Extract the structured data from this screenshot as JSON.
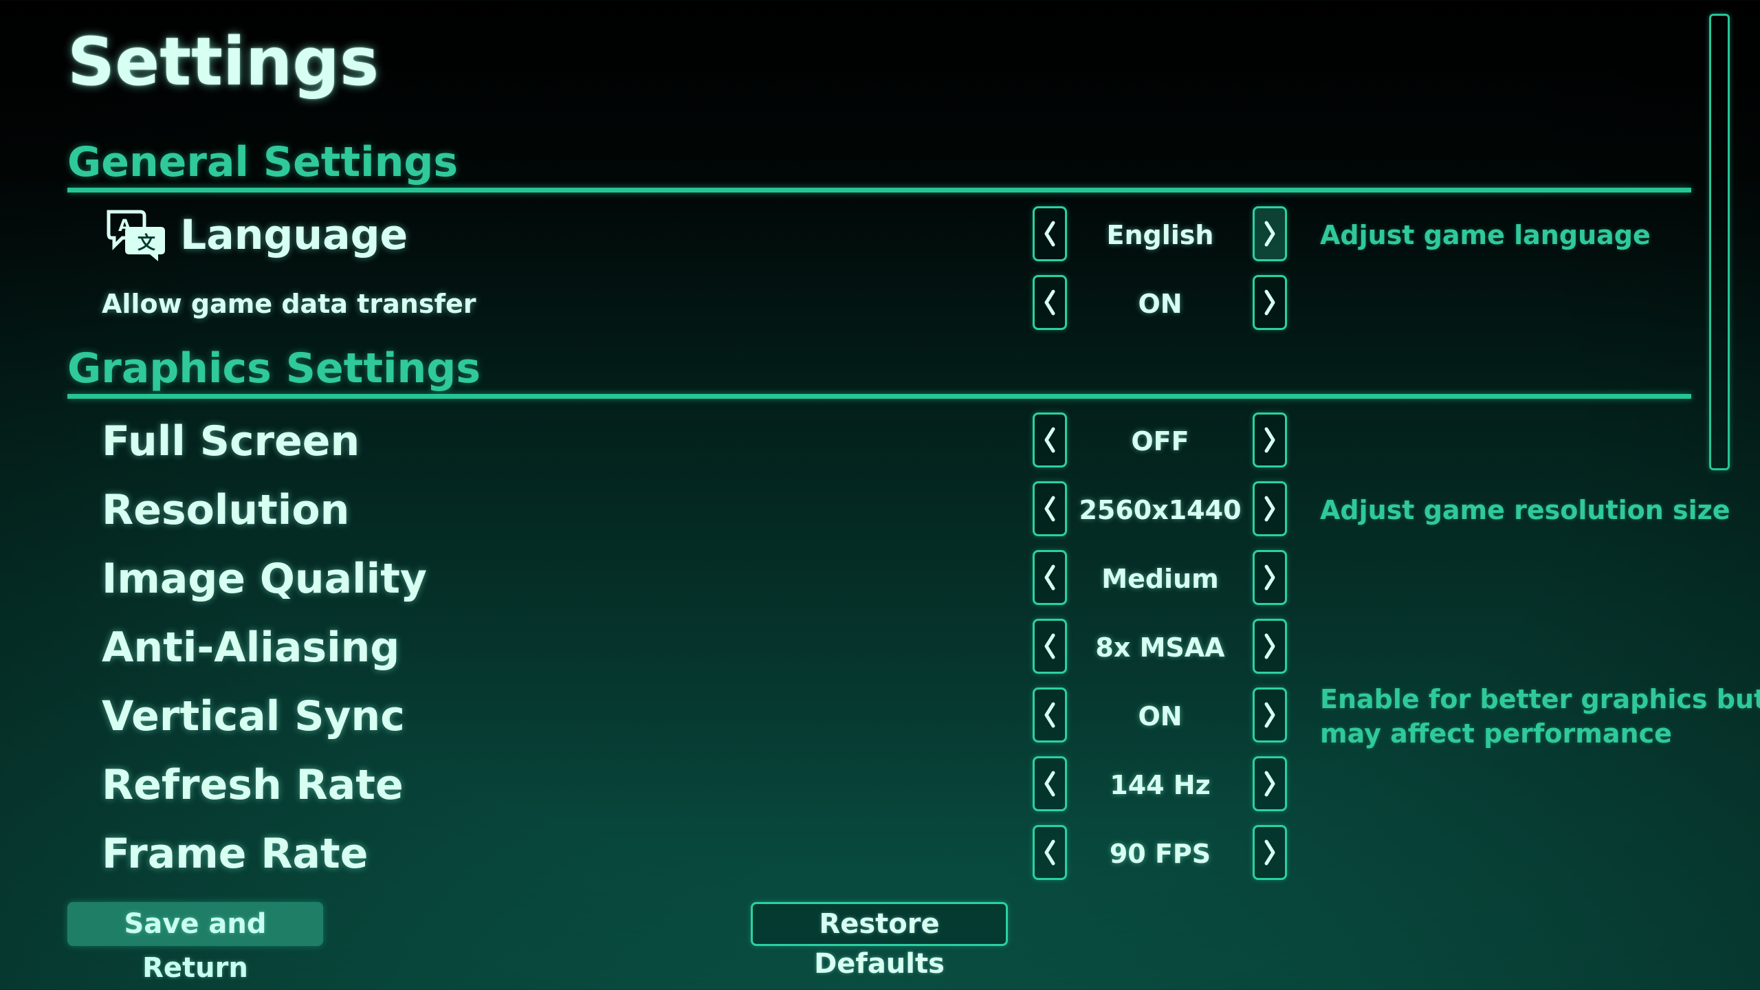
{
  "page_title": "Settings",
  "colors": {
    "accent": "#2fc99a",
    "text": "#d7fff2",
    "background_top": "#000000",
    "background_bottom": "#0a5648"
  },
  "general": {
    "title": "General Settings",
    "language": {
      "icon": "language-translate-icon",
      "label": "Language",
      "value": "English",
      "hint": "Adjust game language",
      "prev_icon": "chevron-left-icon",
      "next_icon": "chevron-right-icon"
    },
    "data_transfer": {
      "label": "Allow game data transfer",
      "value": "ON"
    }
  },
  "graphics": {
    "title": "Graphics Settings",
    "full_screen": {
      "label": "Full Screen",
      "value": "OFF"
    },
    "resolution": {
      "label": "Resolution",
      "value": "2560x1440",
      "hint": "Adjust game resolution size"
    },
    "image_quality": {
      "label": "Image Quality",
      "value": "Medium"
    },
    "anti_aliasing": {
      "label": "Anti-Aliasing",
      "value": "8x MSAA"
    },
    "vertical_sync": {
      "label": "Vertical Sync",
      "value": "ON",
      "hint_line1": "Enable for better graphics but",
      "hint_line2": "may affect performance"
    },
    "refresh_rate": {
      "label": "Refresh Rate",
      "value": "144 Hz"
    },
    "frame_rate": {
      "label": "Frame Rate",
      "value": "90 FPS"
    }
  },
  "footer": {
    "save_label": "Save and Return",
    "restore_label": "Restore Defaults"
  }
}
